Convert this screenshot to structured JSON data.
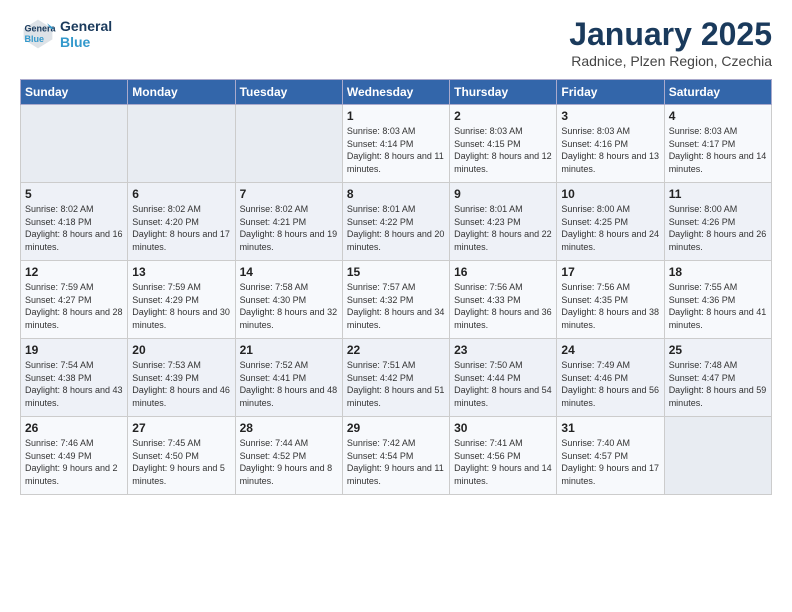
{
  "logo": {
    "line1": "General",
    "line2": "Blue"
  },
  "title": "January 2025",
  "subtitle": "Radnice, Plzen Region, Czechia",
  "weekdays": [
    "Sunday",
    "Monday",
    "Tuesday",
    "Wednesday",
    "Thursday",
    "Friday",
    "Saturday"
  ],
  "weeks": [
    [
      {
        "day": "",
        "sunrise": "",
        "sunset": "",
        "daylight": ""
      },
      {
        "day": "",
        "sunrise": "",
        "sunset": "",
        "daylight": ""
      },
      {
        "day": "",
        "sunrise": "",
        "sunset": "",
        "daylight": ""
      },
      {
        "day": "1",
        "sunrise": "Sunrise: 8:03 AM",
        "sunset": "Sunset: 4:14 PM",
        "daylight": "Daylight: 8 hours and 11 minutes."
      },
      {
        "day": "2",
        "sunrise": "Sunrise: 8:03 AM",
        "sunset": "Sunset: 4:15 PM",
        "daylight": "Daylight: 8 hours and 12 minutes."
      },
      {
        "day": "3",
        "sunrise": "Sunrise: 8:03 AM",
        "sunset": "Sunset: 4:16 PM",
        "daylight": "Daylight: 8 hours and 13 minutes."
      },
      {
        "day": "4",
        "sunrise": "Sunrise: 8:03 AM",
        "sunset": "Sunset: 4:17 PM",
        "daylight": "Daylight: 8 hours and 14 minutes."
      }
    ],
    [
      {
        "day": "5",
        "sunrise": "Sunrise: 8:02 AM",
        "sunset": "Sunset: 4:18 PM",
        "daylight": "Daylight: 8 hours and 16 minutes."
      },
      {
        "day": "6",
        "sunrise": "Sunrise: 8:02 AM",
        "sunset": "Sunset: 4:20 PM",
        "daylight": "Daylight: 8 hours and 17 minutes."
      },
      {
        "day": "7",
        "sunrise": "Sunrise: 8:02 AM",
        "sunset": "Sunset: 4:21 PM",
        "daylight": "Daylight: 8 hours and 19 minutes."
      },
      {
        "day": "8",
        "sunrise": "Sunrise: 8:01 AM",
        "sunset": "Sunset: 4:22 PM",
        "daylight": "Daylight: 8 hours and 20 minutes."
      },
      {
        "day": "9",
        "sunrise": "Sunrise: 8:01 AM",
        "sunset": "Sunset: 4:23 PM",
        "daylight": "Daylight: 8 hours and 22 minutes."
      },
      {
        "day": "10",
        "sunrise": "Sunrise: 8:00 AM",
        "sunset": "Sunset: 4:25 PM",
        "daylight": "Daylight: 8 hours and 24 minutes."
      },
      {
        "day": "11",
        "sunrise": "Sunrise: 8:00 AM",
        "sunset": "Sunset: 4:26 PM",
        "daylight": "Daylight: 8 hours and 26 minutes."
      }
    ],
    [
      {
        "day": "12",
        "sunrise": "Sunrise: 7:59 AM",
        "sunset": "Sunset: 4:27 PM",
        "daylight": "Daylight: 8 hours and 28 minutes."
      },
      {
        "day": "13",
        "sunrise": "Sunrise: 7:59 AM",
        "sunset": "Sunset: 4:29 PM",
        "daylight": "Daylight: 8 hours and 30 minutes."
      },
      {
        "day": "14",
        "sunrise": "Sunrise: 7:58 AM",
        "sunset": "Sunset: 4:30 PM",
        "daylight": "Daylight: 8 hours and 32 minutes."
      },
      {
        "day": "15",
        "sunrise": "Sunrise: 7:57 AM",
        "sunset": "Sunset: 4:32 PM",
        "daylight": "Daylight: 8 hours and 34 minutes."
      },
      {
        "day": "16",
        "sunrise": "Sunrise: 7:56 AM",
        "sunset": "Sunset: 4:33 PM",
        "daylight": "Daylight: 8 hours and 36 minutes."
      },
      {
        "day": "17",
        "sunrise": "Sunrise: 7:56 AM",
        "sunset": "Sunset: 4:35 PM",
        "daylight": "Daylight: 8 hours and 38 minutes."
      },
      {
        "day": "18",
        "sunrise": "Sunrise: 7:55 AM",
        "sunset": "Sunset: 4:36 PM",
        "daylight": "Daylight: 8 hours and 41 minutes."
      }
    ],
    [
      {
        "day": "19",
        "sunrise": "Sunrise: 7:54 AM",
        "sunset": "Sunset: 4:38 PM",
        "daylight": "Daylight: 8 hours and 43 minutes."
      },
      {
        "day": "20",
        "sunrise": "Sunrise: 7:53 AM",
        "sunset": "Sunset: 4:39 PM",
        "daylight": "Daylight: 8 hours and 46 minutes."
      },
      {
        "day": "21",
        "sunrise": "Sunrise: 7:52 AM",
        "sunset": "Sunset: 4:41 PM",
        "daylight": "Daylight: 8 hours and 48 minutes."
      },
      {
        "day": "22",
        "sunrise": "Sunrise: 7:51 AM",
        "sunset": "Sunset: 4:42 PM",
        "daylight": "Daylight: 8 hours and 51 minutes."
      },
      {
        "day": "23",
        "sunrise": "Sunrise: 7:50 AM",
        "sunset": "Sunset: 4:44 PM",
        "daylight": "Daylight: 8 hours and 54 minutes."
      },
      {
        "day": "24",
        "sunrise": "Sunrise: 7:49 AM",
        "sunset": "Sunset: 4:46 PM",
        "daylight": "Daylight: 8 hours and 56 minutes."
      },
      {
        "day": "25",
        "sunrise": "Sunrise: 7:48 AM",
        "sunset": "Sunset: 4:47 PM",
        "daylight": "Daylight: 8 hours and 59 minutes."
      }
    ],
    [
      {
        "day": "26",
        "sunrise": "Sunrise: 7:46 AM",
        "sunset": "Sunset: 4:49 PM",
        "daylight": "Daylight: 9 hours and 2 minutes."
      },
      {
        "day": "27",
        "sunrise": "Sunrise: 7:45 AM",
        "sunset": "Sunset: 4:50 PM",
        "daylight": "Daylight: 9 hours and 5 minutes."
      },
      {
        "day": "28",
        "sunrise": "Sunrise: 7:44 AM",
        "sunset": "Sunset: 4:52 PM",
        "daylight": "Daylight: 9 hours and 8 minutes."
      },
      {
        "day": "29",
        "sunrise": "Sunrise: 7:42 AM",
        "sunset": "Sunset: 4:54 PM",
        "daylight": "Daylight: 9 hours and 11 minutes."
      },
      {
        "day": "30",
        "sunrise": "Sunrise: 7:41 AM",
        "sunset": "Sunset: 4:56 PM",
        "daylight": "Daylight: 9 hours and 14 minutes."
      },
      {
        "day": "31",
        "sunrise": "Sunrise: 7:40 AM",
        "sunset": "Sunset: 4:57 PM",
        "daylight": "Daylight: 9 hours and 17 minutes."
      },
      {
        "day": "",
        "sunrise": "",
        "sunset": "",
        "daylight": ""
      }
    ]
  ]
}
